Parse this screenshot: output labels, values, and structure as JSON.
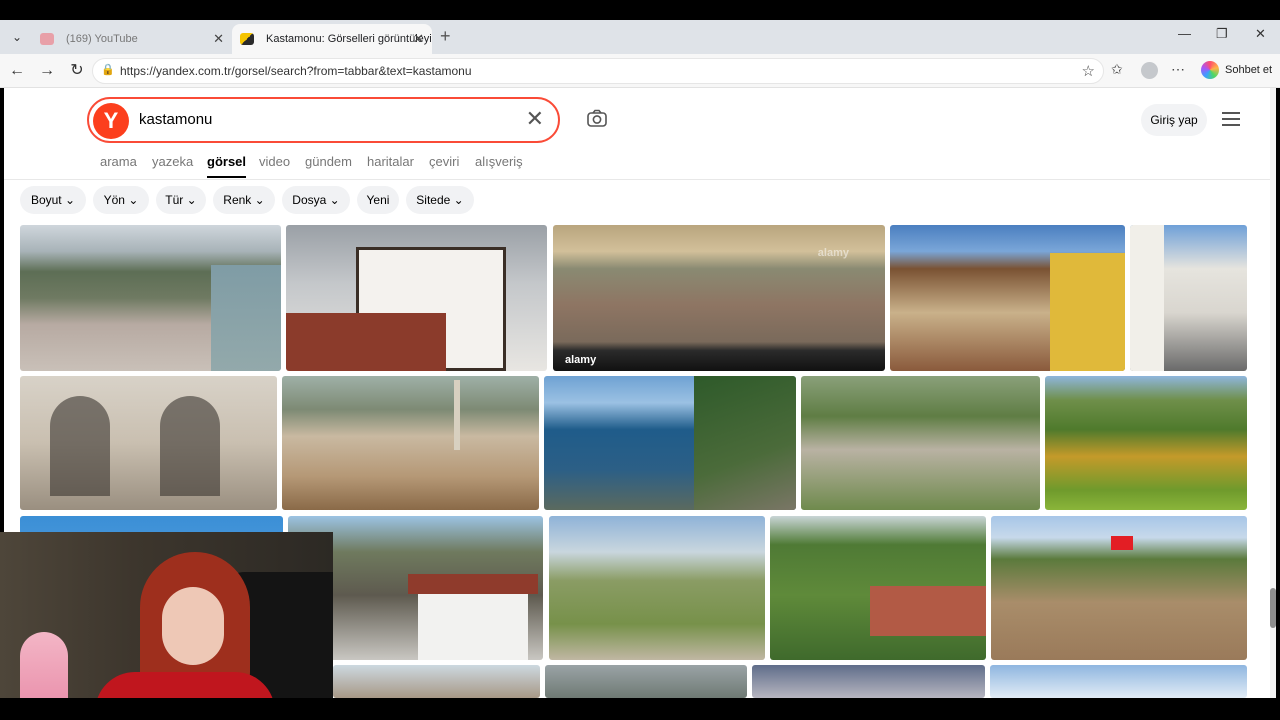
{
  "browser": {
    "tabs": [
      {
        "title": "(169) YouTube",
        "active": false
      },
      {
        "title": "Kastamonu: Görselleri görüntüleyi",
        "active": true
      }
    ],
    "new_tab_label": "+",
    "url": "https://yandex.com.tr/gorsel/search?from=tabbar&text=kastamonu",
    "copilot_label": "Sohbet et"
  },
  "search": {
    "logo_letter": "Y",
    "query": "kastamonu",
    "login_label": "Giriş yap"
  },
  "services": [
    "arama",
    "yazeka",
    "görsel",
    "video",
    "gündem",
    "haritalar",
    "çeviri",
    "alışveriş"
  ],
  "active_service": "görsel",
  "filters": [
    "Boyut",
    "Yön",
    "Tür",
    "Renk",
    "Dosya",
    "Yeni",
    "Sitede"
  ],
  "filters_with_dropdown": [
    "Boyut",
    "Yön",
    "Tür",
    "Renk",
    "Dosya",
    "Sitede"
  ],
  "image_watermarks": {
    "alamy_top": "alamy",
    "alamy_bottom": "alamy"
  },
  "colors": {
    "yandex_red": "#fc3f1d",
    "search_border": "#fa4b37",
    "chip_bg": "#f1f2f4"
  }
}
